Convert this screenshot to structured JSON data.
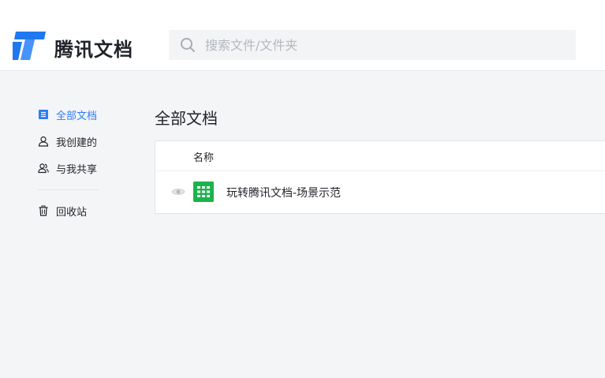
{
  "header": {
    "brand": "腾讯文档",
    "logo_icon": "tencent-docs-logo-icon",
    "search": {
      "placeholder": "搜索文件/文件夹",
      "value": "",
      "icon": "search-icon"
    }
  },
  "sidebar": {
    "items": [
      {
        "label": "全部文档",
        "icon": "document-list-icon",
        "active": true
      },
      {
        "label": "我创建的",
        "icon": "user-icon",
        "active": false
      },
      {
        "label": "与我共享",
        "icon": "users-shared-icon",
        "active": false
      }
    ],
    "trash": {
      "label": "回收站",
      "icon": "trash-icon"
    }
  },
  "main": {
    "title": "全部文档",
    "table": {
      "header_name": "名称",
      "rows": [
        {
          "name": "玩转腾讯文档-场景示范",
          "type_icon": "spreadsheet-icon",
          "status_icon": "eye-icon"
        }
      ]
    }
  },
  "colors": {
    "accent": "#2e7cf6",
    "sheet_green": "#1bb34c",
    "page_bg": "#f4f5f7",
    "header_bg": "#ffffff"
  }
}
